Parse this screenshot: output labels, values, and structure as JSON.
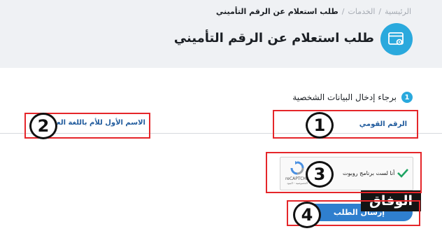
{
  "breadcrumb": {
    "home": "الرئيسية",
    "services": "الخدمات",
    "current": "طلب استعلام عن الرقم التأميني",
    "separator": "/"
  },
  "page": {
    "title": "طلب استعلام عن الرقم التأميني",
    "icon": "window-settings-icon"
  },
  "step": {
    "number": "1",
    "label": "برجاء إدخال البيانات الشخصية"
  },
  "form": {
    "national_id_label": "الرقم القومي",
    "mother_name_label": "الاسم الأول للأم باللغة العربية"
  },
  "recaptcha": {
    "label": "أنا لست برنامج روبوت",
    "brand": "reCAPTCHA",
    "links": "الخصوصية - البنود"
  },
  "submit": {
    "label": "إرسال الطلب"
  },
  "annotations": [
    "1",
    "2",
    "3",
    "4"
  ],
  "watermark": "الوفاق",
  "colors": {
    "accent": "#2aa9dd",
    "button": "#2f7fce",
    "label": "#1f5a9c",
    "annotation": "#e5262a"
  }
}
